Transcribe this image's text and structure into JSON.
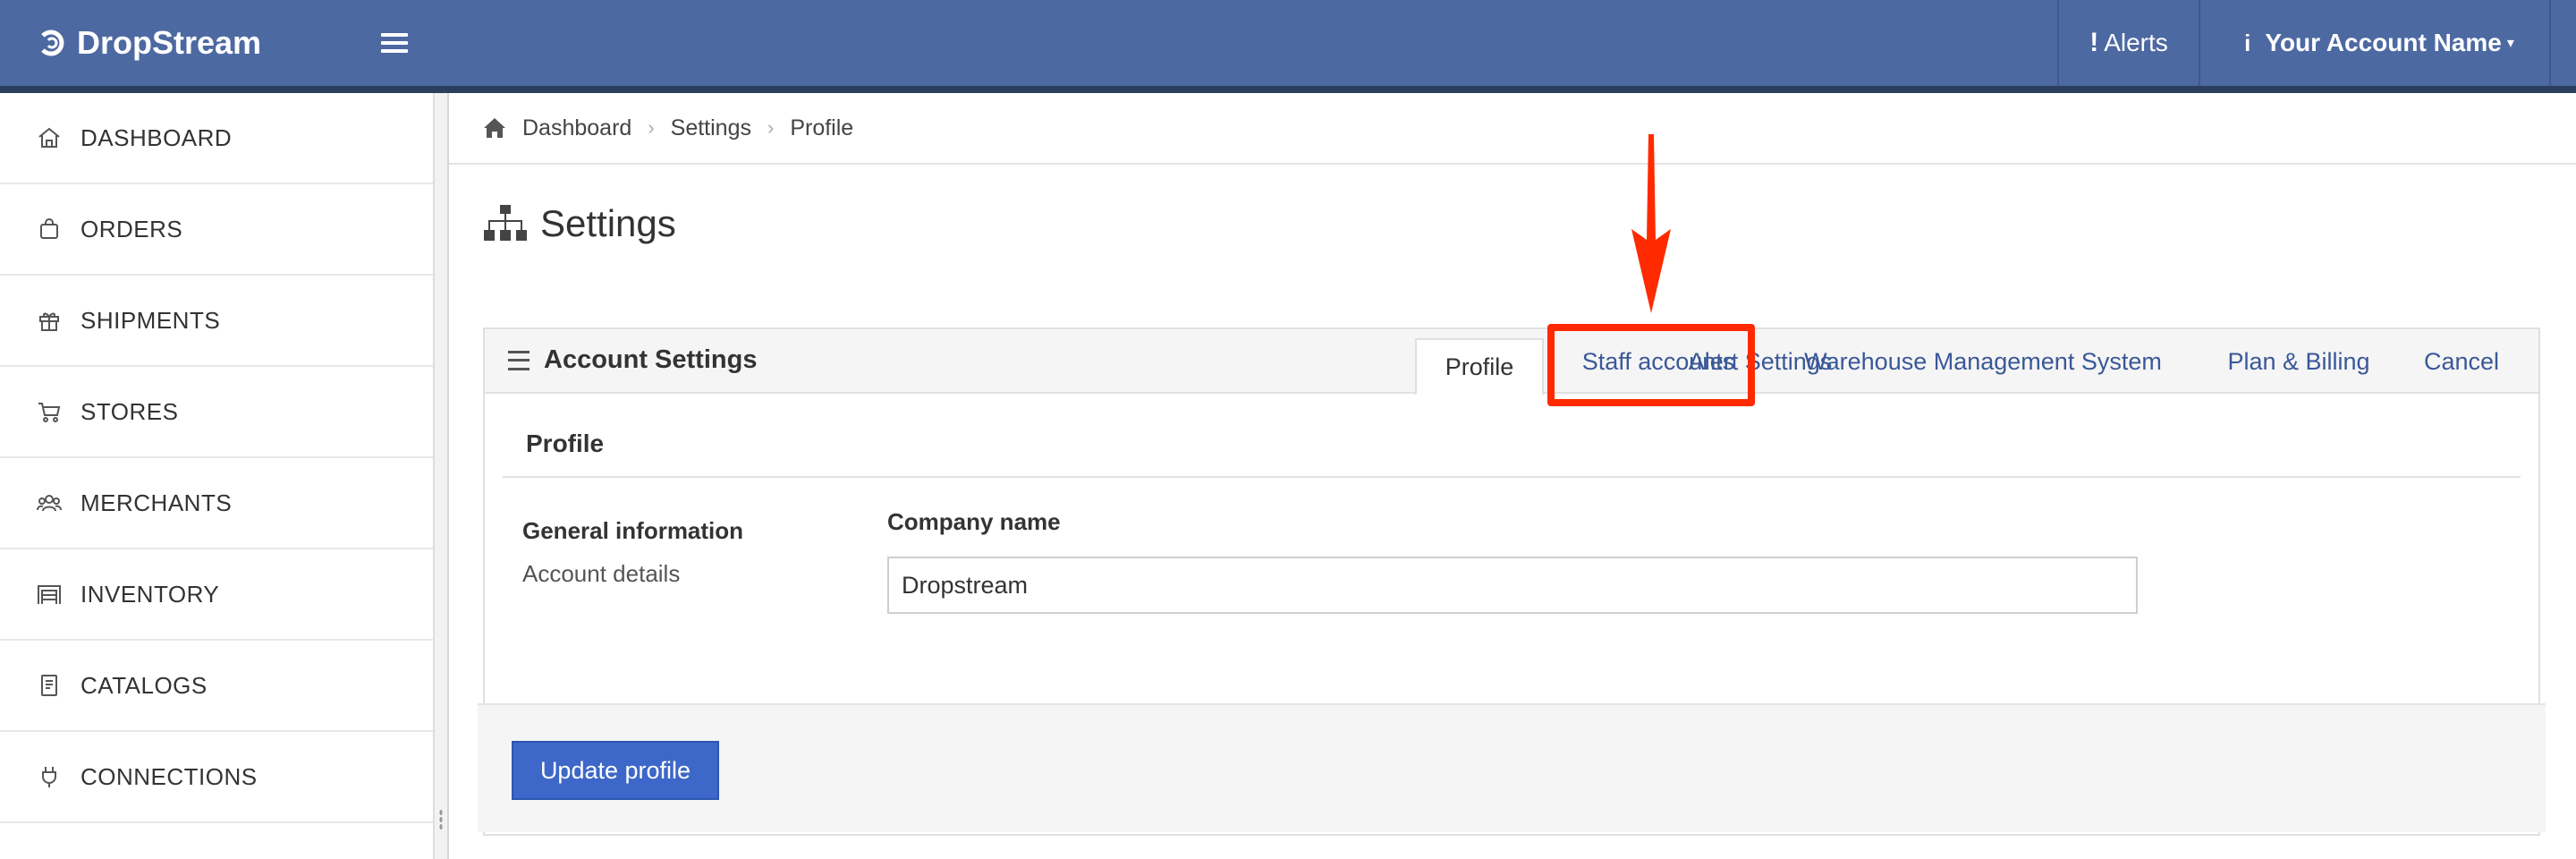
{
  "header": {
    "brand": "DropStream",
    "alerts_label": "Alerts",
    "account_label": "Your Account Name"
  },
  "sidebar": {
    "items": [
      {
        "label": "DASHBOARD",
        "icon": "home-icon"
      },
      {
        "label": "ORDERS",
        "icon": "shopping-bag-icon"
      },
      {
        "label": "SHIPMENTS",
        "icon": "gift-box-icon"
      },
      {
        "label": "STORES",
        "icon": "cart-icon"
      },
      {
        "label": "MERCHANTS",
        "icon": "users-icon"
      },
      {
        "label": "INVENTORY",
        "icon": "warehouse-icon"
      },
      {
        "label": "CATALOGS",
        "icon": "book-icon"
      },
      {
        "label": "CONNECTIONS",
        "icon": "plug-icon"
      }
    ]
  },
  "breadcrumb": [
    "Dashboard",
    "Settings",
    "Profile"
  ],
  "page": {
    "title": "Settings"
  },
  "panel": {
    "title": "Account Settings",
    "tabs": [
      {
        "label": "Alert Settings",
        "active": false
      },
      {
        "label": "Profile",
        "active": true
      },
      {
        "label": "Staff accounts",
        "active": false,
        "highlighted": true
      },
      {
        "label": "Warehouse Management System",
        "active": false
      },
      {
        "label": "Plan & Billing",
        "active": false
      },
      {
        "label": "Cancel",
        "active": false
      }
    ],
    "section_title": "Profile",
    "general_info_title": "General information",
    "general_info_sub": "Account details",
    "company_label": "Company name",
    "company_value": "Dropstream",
    "update_button": "Update profile"
  },
  "colors": {
    "topbar": "#4d69a2",
    "link": "#3a5898",
    "primary_button": "#3d67c8",
    "annotation": "#ff2a00"
  }
}
